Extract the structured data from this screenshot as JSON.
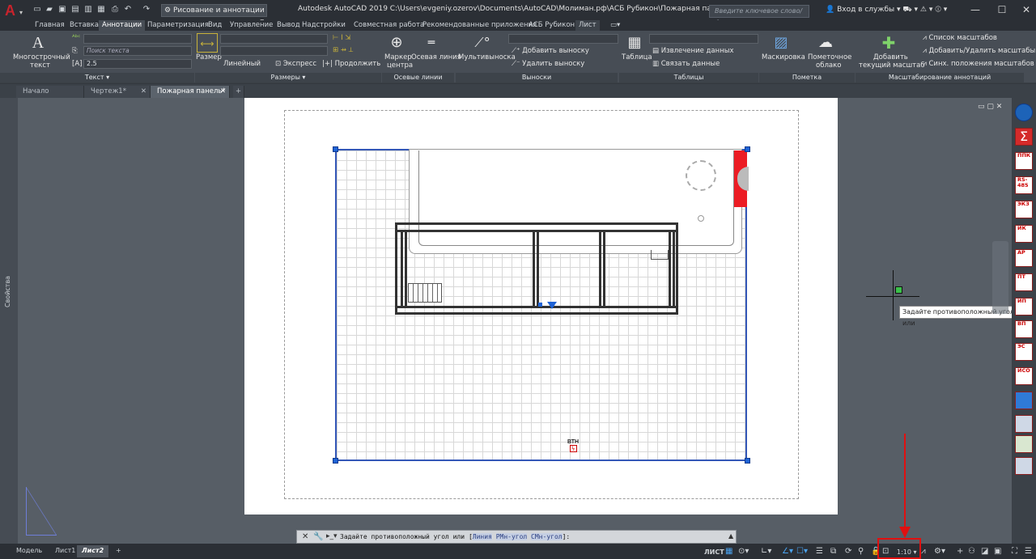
{
  "title_bar": {
    "workspace": "Рисование и аннотации",
    "title": "Autodesk AutoCAD 2019     C:\\Users\\evgeniy.ozerov\\Documents\\AutoCAD\\Моли­ман.рф\\АСБ Рубикон\\Пожарная панель.dwg",
    "search_placeholder": "Введите ключевое слово/фразу",
    "signin": "Вход в службы"
  },
  "ribbon_tabs": [
    "Главная",
    "Вставка",
    "Аннотации",
    "Параметризация",
    "Вид",
    "Управление",
    "Вывод",
    "Надстройки",
    "Совместная работа",
    "Рекомендованные приложения",
    "АСБ Рубикон",
    "Лист"
  ],
  "ribbon": {
    "text_panel": {
      "big_label_1": "Многострочный",
      "big_label_2": "текст",
      "search_placeholder": "Поиск текста",
      "height_value": "2.5",
      "footer": "Текст ▾"
    },
    "dim_panel": {
      "big_label": "Размер",
      "linear": "Линейный",
      "express": "Экспресс",
      "continue": "Продолжить",
      "footer": "Размеры ▾"
    },
    "center_panel": {
      "marker_1": "Маркер",
      "marker_2": "центра",
      "axis": "Осевая линия",
      "footer": "Осевые линии"
    },
    "leader_panel": {
      "big_label": "Мультивыноска",
      "add": "Добавить выноску",
      "remove": "Удалить выноску",
      "footer": "Выноски"
    },
    "table_panel": {
      "big_label": "Таблица",
      "extract": "Извлечение данных",
      "link": "Связать данные",
      "footer": "Таблицы"
    },
    "markup_panel": {
      "wipeout": "Маскировка",
      "cloud_1": "Пометочное",
      "cloud_2": "облако",
      "footer": "Пометка"
    },
    "scale_panel": {
      "add_1": "Добавить",
      "add_2": "текущий масштаб",
      "list": "Список масштабов",
      "addremove": "Добавить/Удалить масштабы",
      "sync": "Синх. положения масштабов",
      "footer": "Масштабирование аннотаций"
    }
  },
  "doc_tabs": [
    "Начало",
    "Чертеж1*",
    "Пожарная панель*"
  ],
  "canvas": {
    "vth_label": "ВТН",
    "props_label": "Свойства",
    "tooltip": "Задайте противоположный угол или"
  },
  "command": {
    "prompt": "Задайте противоположный угол или [",
    "opt1": "Линия",
    "opt2": "РМн-угол",
    "opt3": "СМн-угол",
    "suffix": "]:"
  },
  "status": {
    "model_tabs": [
      "Модель",
      "Лист1",
      "Лист2"
    ],
    "mode": "ЛИСТ",
    "scale": "1:10"
  },
  "right_palette": [
    "ППК",
    "RS-485",
    "ЭКЗ",
    "ИК",
    "АР",
    "ПТ",
    "ИП",
    "ВП",
    "ЭС",
    "ИСО"
  ]
}
